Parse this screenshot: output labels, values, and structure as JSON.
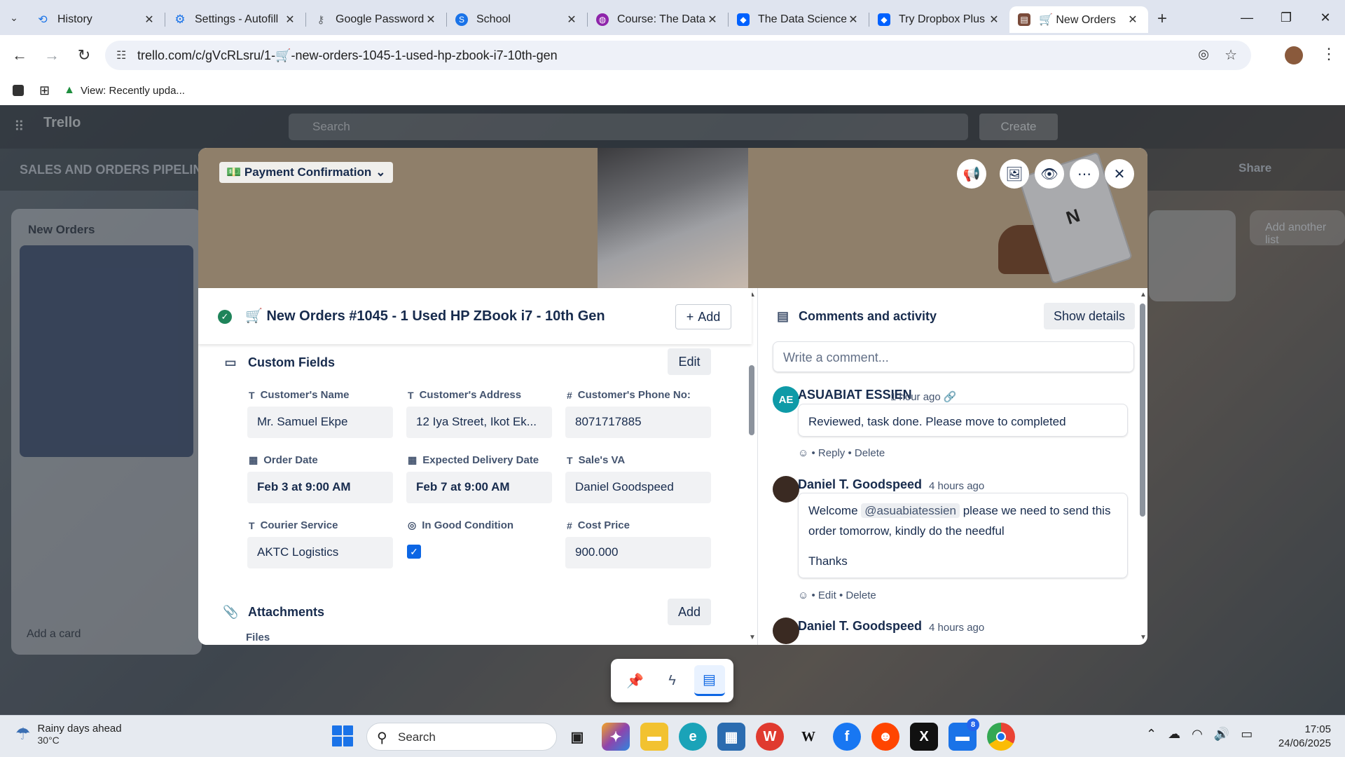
{
  "browser": {
    "tabs": [
      {
        "title": "History",
        "favicon_color": "#1a73e8"
      },
      {
        "title": "Settings - Autofill",
        "favicon_color": "#1a73e8"
      },
      {
        "title": "Google Passwords",
        "favicon_color": "#5f6368"
      },
      {
        "title": "School",
        "favicon_color": "#1a73e8"
      },
      {
        "title": "Course: The Data",
        "favicon_color": "#8e24aa"
      },
      {
        "title": "The Data Science",
        "favicon_color": "#0061fe"
      },
      {
        "title": "Try Dropbox Plus",
        "favicon_color": "#0061fe"
      },
      {
        "title": "🛒 New Orders",
        "favicon_color": "#7a4b3a"
      }
    ],
    "url": "trello.com/c/gVcRLsru/1-🛒-new-orders-1045-1-used-hp-zbook-i7-10th-gen",
    "bookmark": "View: Recently upda..."
  },
  "trello": {
    "app_name": "Trello",
    "search_placeholder": "Search",
    "create_label": "Create",
    "board_title": "SALES AND ORDERS PIPELINE",
    "share_label": "Share",
    "list_title": "New Orders",
    "add_card": "Add a card",
    "add_list": "Add another list"
  },
  "card": {
    "cover_label": "💵 Payment Confirmation",
    "title": "🛒 New Orders #1045 - 1 Used HP ZBook i7 - 10th Gen",
    "add_label": "Add",
    "custom_fields_title": "Custom Fields",
    "edit_label": "Edit",
    "fields": [
      {
        "label": "Customer's Name",
        "icon": "text-icon",
        "value": "Mr. Samuel Ekpe"
      },
      {
        "label": "Customer's Address",
        "icon": "text-icon",
        "value": "12 Iya Street, Ikot Ek..."
      },
      {
        "label": "Customer's Phone No:",
        "icon": "hash-icon",
        "value": "8071717885"
      },
      {
        "label": "Order Date",
        "icon": "calendar-icon",
        "value": "Feb 3 at 9:00 AM"
      },
      {
        "label": "Expected Delivery Date",
        "icon": "calendar-icon",
        "value": "Feb 7 at 9:00 AM"
      },
      {
        "label": "Sale's VA",
        "icon": "text-icon",
        "value": "Daniel Goodspeed"
      },
      {
        "label": "Courier Service",
        "icon": "text-icon",
        "value": "AKTC Logistics"
      },
      {
        "label": "In Good Condition",
        "icon": "check-circle-icon",
        "value": "checked"
      },
      {
        "label": "Cost Price",
        "icon": "hash-icon",
        "value": "900.000"
      }
    ],
    "attachments_title": "Attachments",
    "attachments_add": "Add",
    "files_label": "Files"
  },
  "activity": {
    "title": "Comments and activity",
    "show_details": "Show details",
    "comment_placeholder": "Write a comment...",
    "comments": [
      {
        "author": "ASUABIAT ESSIEN",
        "initials": "AE",
        "time": "1 hour ago",
        "text": "Reviewed, task done. Please move to completed",
        "actions": [
          "Reply",
          "Delete"
        ],
        "avatar_color": "#0e9aa7"
      },
      {
        "author": "Daniel T. Goodspeed",
        "time": "4 hours ago",
        "text_before": "Welcome",
        "mention": "@asuabiatessien",
        "text_after": "please we need to send this order tomorrow, kindly do the needful",
        "text_line2": "Thanks",
        "actions": [
          "Edit",
          "Delete"
        ]
      },
      {
        "author": "Daniel T. Goodspeed",
        "time": "4 hours ago"
      }
    ]
  },
  "taskbar": {
    "weather_title": "Rainy days ahead",
    "weather_temp": "30°C",
    "search_placeholder": "Search",
    "notification_badge": "8",
    "time": "17:05",
    "date": "24/06/2025"
  }
}
